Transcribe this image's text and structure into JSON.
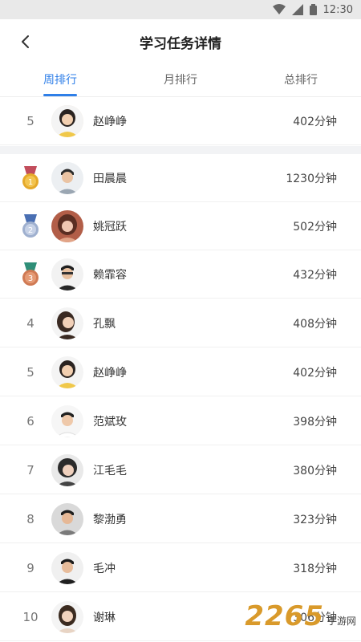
{
  "status": {
    "time": "12:30"
  },
  "header": {
    "title": "学习任务详情"
  },
  "tabs": [
    {
      "label": "周排行",
      "active": true
    },
    {
      "label": "月排行",
      "active": false
    },
    {
      "label": "总排行",
      "active": false
    }
  ],
  "current_user": {
    "rank": "5",
    "name": "赵峥峥",
    "value": "402分钟",
    "avatar_icon": "avatar-female-icon"
  },
  "ranking": [
    {
      "rank": "1",
      "medal": "gold-medal-icon",
      "name": "田晨晨",
      "value": "1230分钟",
      "avatar_icon": "avatar-male-icon"
    },
    {
      "rank": "2",
      "medal": "silver-medal-icon",
      "name": "姚冠跃",
      "value": "502分钟",
      "avatar_icon": "avatar-female-icon"
    },
    {
      "rank": "3",
      "medal": "bronze-medal-icon",
      "name": "赖霏容",
      "value": "432分钟",
      "avatar_icon": "avatar-male-icon"
    },
    {
      "rank": "4",
      "name": "孔飘",
      "value": "408分钟",
      "avatar_icon": "avatar-female-icon"
    },
    {
      "rank": "5",
      "name": "赵峥峥",
      "value": "402分钟",
      "avatar_icon": "avatar-female-icon"
    },
    {
      "rank": "6",
      "name": "范斌玫",
      "value": "398分钟",
      "avatar_icon": "avatar-male-icon"
    },
    {
      "rank": "7",
      "name": "江毛毛",
      "value": "380分钟",
      "avatar_icon": "avatar-female-icon"
    },
    {
      "rank": "8",
      "name": "黎渤勇",
      "value": "323分钟",
      "avatar_icon": "avatar-male-icon"
    },
    {
      "rank": "9",
      "name": "毛冲",
      "value": "318分钟",
      "avatar_icon": "avatar-male-icon"
    },
    {
      "rank": "10",
      "name": "谢琳",
      "value": "306分钟",
      "avatar_icon": "avatar-female-icon"
    }
  ],
  "colors": {
    "accent": "#2f7fe8",
    "gold": "#e5a92a",
    "silver": "#9fb0cf",
    "bronze": "#d07a54"
  },
  "watermark": {
    "number": "2265",
    "text": "手游网"
  }
}
